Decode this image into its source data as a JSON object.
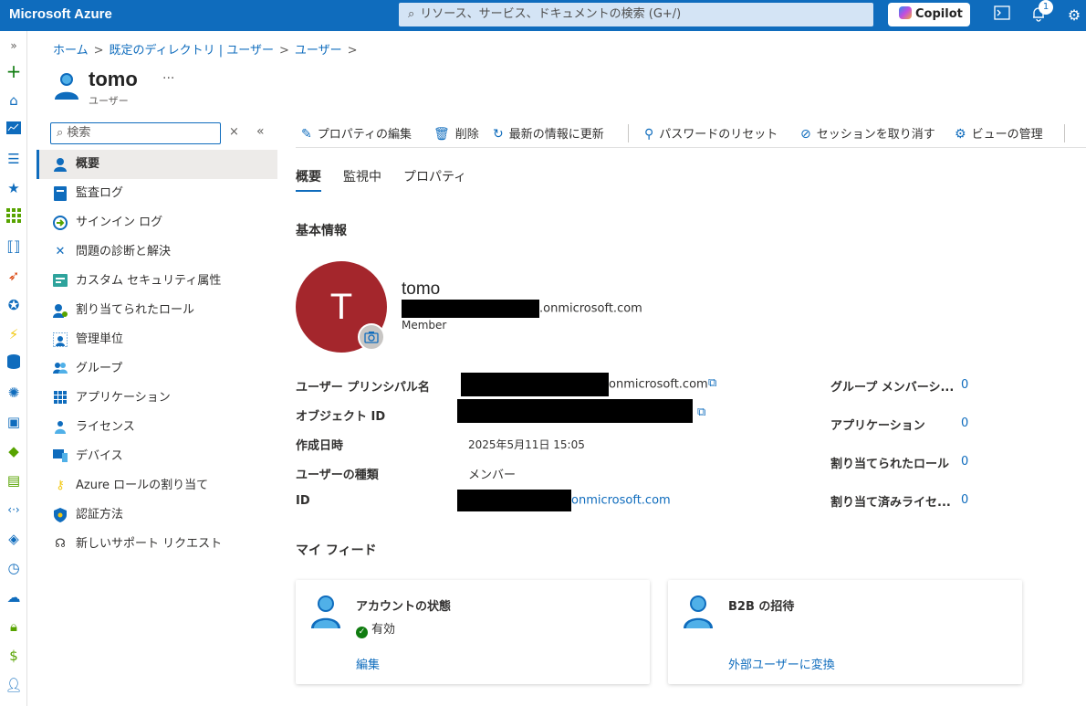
{
  "topbar": {
    "brand": "Microsoft Azure",
    "search_placeholder": "リソース、サービス、ドキュメントの検索 (G+/)",
    "copilot_label": "Copilot",
    "notification_count": "1"
  },
  "breadcrumb": {
    "items": [
      "ホーム",
      "既定のディレクトリ | ユーザー",
      "ユーザー"
    ],
    "separator": ">"
  },
  "header": {
    "title": "tomo",
    "subtitle": "ユーザー",
    "more": "···"
  },
  "nav": {
    "search_placeholder": "検索",
    "clear": "×",
    "collapse": "«",
    "items": [
      {
        "label": "概要",
        "icon": "user-icon"
      },
      {
        "label": "監査ログ",
        "icon": "audit-log-icon"
      },
      {
        "label": "サインイン ログ",
        "icon": "signin-log-icon"
      },
      {
        "label": "問題の診断と解決",
        "icon": "wrench-icon"
      },
      {
        "label": "カスタム セキュリティ属性",
        "icon": "security-attribute-icon"
      },
      {
        "label": "割り当てられたロール",
        "icon": "role-icon"
      },
      {
        "label": "管理単位",
        "icon": "admin-unit-icon"
      },
      {
        "label": "グループ",
        "icon": "group-icon"
      },
      {
        "label": "アプリケーション",
        "icon": "app-grid-icon"
      },
      {
        "label": "ライセンス",
        "icon": "license-icon"
      },
      {
        "label": "デバイス",
        "icon": "device-icon"
      },
      {
        "label": "Azure ロールの割り当て",
        "icon": "key-icon"
      },
      {
        "label": "認証方法",
        "icon": "shield-icon"
      },
      {
        "label": "新しいサポート リクエスト",
        "icon": "support-icon"
      }
    ]
  },
  "commands": {
    "edit": "プロパティの編集",
    "delete": "削除",
    "refresh": "最新の情報に更新",
    "reset_password": "パスワードのリセット",
    "revoke_sessions": "セッションを取り消す",
    "manage_view": "ビューの管理"
  },
  "tabs": [
    "概要",
    "監視中",
    "プロパティ"
  ],
  "basic_info": {
    "heading": "基本情報",
    "avatar_letter": "T",
    "display_name": "tomo",
    "email_suffix": ".onmicrosoft.com",
    "member_type": "Member"
  },
  "properties": {
    "upn_label": "ユーザー プリンシパル名",
    "upn_suffix": "onmicrosoft.com",
    "object_id_label": "オブジェクト ID",
    "created_label": "作成日時",
    "created_value": "2025年5月11日 15:05",
    "user_type_label": "ユーザーの種類",
    "user_type_value": "メンバー",
    "id_label": "ID",
    "id_suffix": "onmicrosoft.com"
  },
  "side_stats": [
    {
      "label": "グループ メンバーシ...",
      "value": "0"
    },
    {
      "label": "アプリケーション",
      "value": "0"
    },
    {
      "label": "割り当てられたロール",
      "value": "0"
    },
    {
      "label": "割り当て済みライセ...",
      "value": "0"
    }
  ],
  "feed": {
    "heading": "マイ フィード",
    "cards": [
      {
        "title": "アカウントの状態",
        "status": "有効",
        "link": "編集"
      },
      {
        "title": "B2B の招待",
        "link": "外部ユーザーに変換"
      }
    ]
  },
  "colors": {
    "azure_blue": "#0f6cbd",
    "avatar_red": "#a4262c",
    "status_green": "#107c10"
  }
}
